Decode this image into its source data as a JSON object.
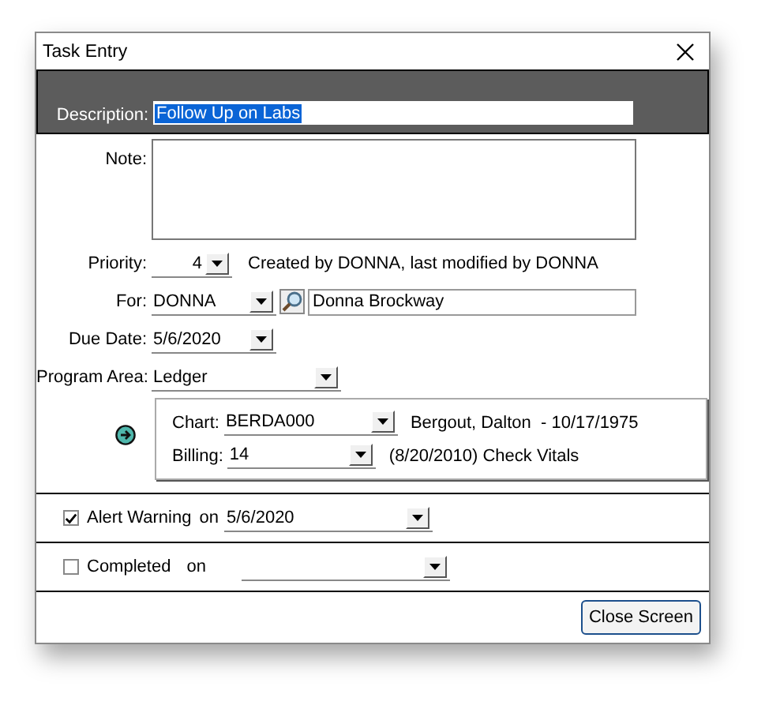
{
  "window": {
    "title": "Task Entry"
  },
  "description": {
    "label": "Description:",
    "value": "Follow Up on Labs",
    "selected": true
  },
  "note": {
    "label": "Note:"
  },
  "priority": {
    "label": "Priority:",
    "value": "4"
  },
  "audit_text": "Created by DONNA, last modified by DONNA",
  "for": {
    "label": "For:",
    "value": "DONNA",
    "name": "Donna Brockway"
  },
  "due_date": {
    "label": "Due Date:",
    "value": "5/6/2020"
  },
  "program_area": {
    "label": "Program Area:",
    "value": "Ledger"
  },
  "chart": {
    "label": "Chart:",
    "value": "BERDA000",
    "info": "Bergout, Dalton  - 10/17/1975"
  },
  "billing": {
    "label": "Billing:",
    "value": "14",
    "info": "(8/20/2010) Check Vitals"
  },
  "alert": {
    "label": "Alert Warning",
    "on": "on",
    "date": "5/6/2020",
    "checked": true
  },
  "completed": {
    "label": "Completed",
    "on": "on",
    "checked": false
  },
  "buttons": [
    "Close Screen"
  ]
}
